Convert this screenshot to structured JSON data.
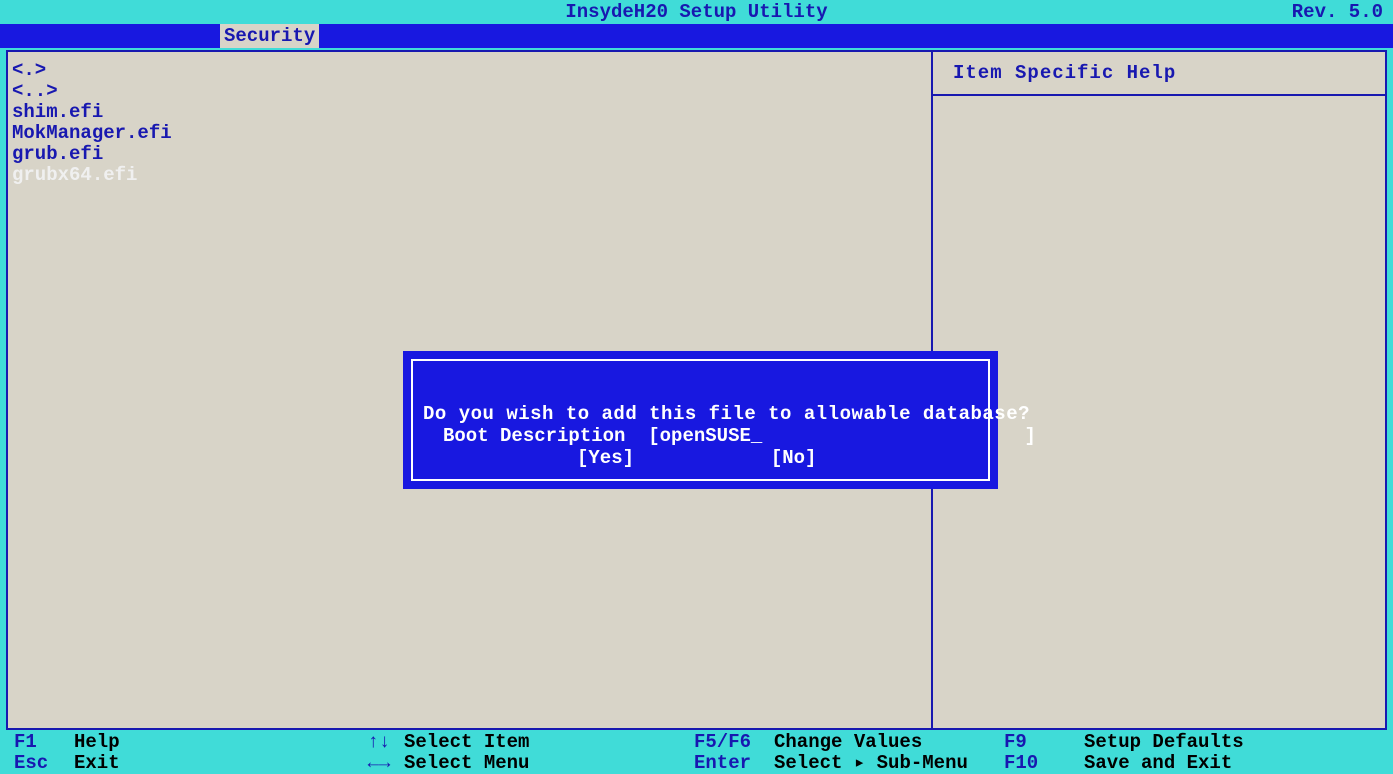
{
  "header": {
    "title": "InsydeH20 Setup Utility",
    "revision": "Rev. 5.0"
  },
  "menubar": {
    "active_tab": "Security"
  },
  "leftpane": {
    "items": [
      {
        "label": "<.>",
        "selected": false
      },
      {
        "label": "<..>",
        "selected": false
      },
      {
        "label": "shim.efi",
        "selected": false
      },
      {
        "label": "MokManager.efi",
        "selected": false
      },
      {
        "label": "grub.efi",
        "selected": false
      },
      {
        "label": "grubx64.efi",
        "selected": true
      }
    ]
  },
  "rightpane": {
    "help_title": "Item Specific Help"
  },
  "dialog": {
    "question": "Do you wish to add this file to allowable database?",
    "desc_label": "Boot Description",
    "desc_value": "openSUSE",
    "yes_label": "[Yes]",
    "no_label": "[No]"
  },
  "footer": {
    "row1": {
      "k1": "F1",
      "a1": "Help",
      "k2": "↑↓",
      "a2": "Select Item",
      "k3": "F5/F6",
      "a3": "Change Values",
      "k4": "F9",
      "a4": "Setup Defaults"
    },
    "row2": {
      "k1": "Esc",
      "a1": "Exit",
      "k2": "←→",
      "a2": "Select Menu",
      "k3": "Enter",
      "a3": "Select ▸ Sub-Menu",
      "k4": "F10",
      "a4": "Save and Exit"
    }
  }
}
